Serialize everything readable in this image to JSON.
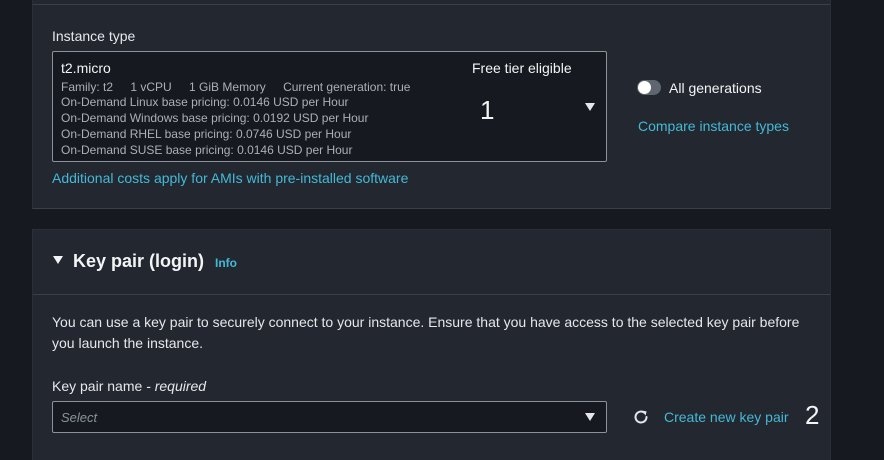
{
  "instance_type": {
    "label": "Instance type",
    "selected": {
      "name": "t2.micro",
      "family": "Family: t2",
      "vcpu": "1 vCPU",
      "memory": "1 GiB Memory",
      "generation": "Current generation: true",
      "pricing": [
        "On-Demand Linux base pricing: 0.0146 USD per Hour",
        "On-Demand Windows base pricing: 0.0192 USD per Hour",
        "On-Demand RHEL base pricing: 0.0746 USD per Hour",
        "On-Demand SUSE base pricing: 0.0146 USD per Hour"
      ],
      "badge": "Free tier eligible"
    },
    "annotation": "1",
    "all_generations_label": "All generations",
    "all_generations_on": false,
    "compare_link": "Compare instance types",
    "additional_costs_link": "Additional costs apply for AMIs with pre-installed software"
  },
  "key_pair": {
    "title": "Key pair (login)",
    "info_link": "Info",
    "description": "You can use a key pair to securely connect to your instance. Ensure that you have access to the selected key pair before you launch the instance.",
    "field_label": "Key pair name",
    "field_required": " - required",
    "select_placeholder": "Select",
    "create_link": "Create new key pair",
    "annotation": "2"
  },
  "colors": {
    "background": "#16191f",
    "panel": "#232730",
    "link": "#44b9d6"
  }
}
